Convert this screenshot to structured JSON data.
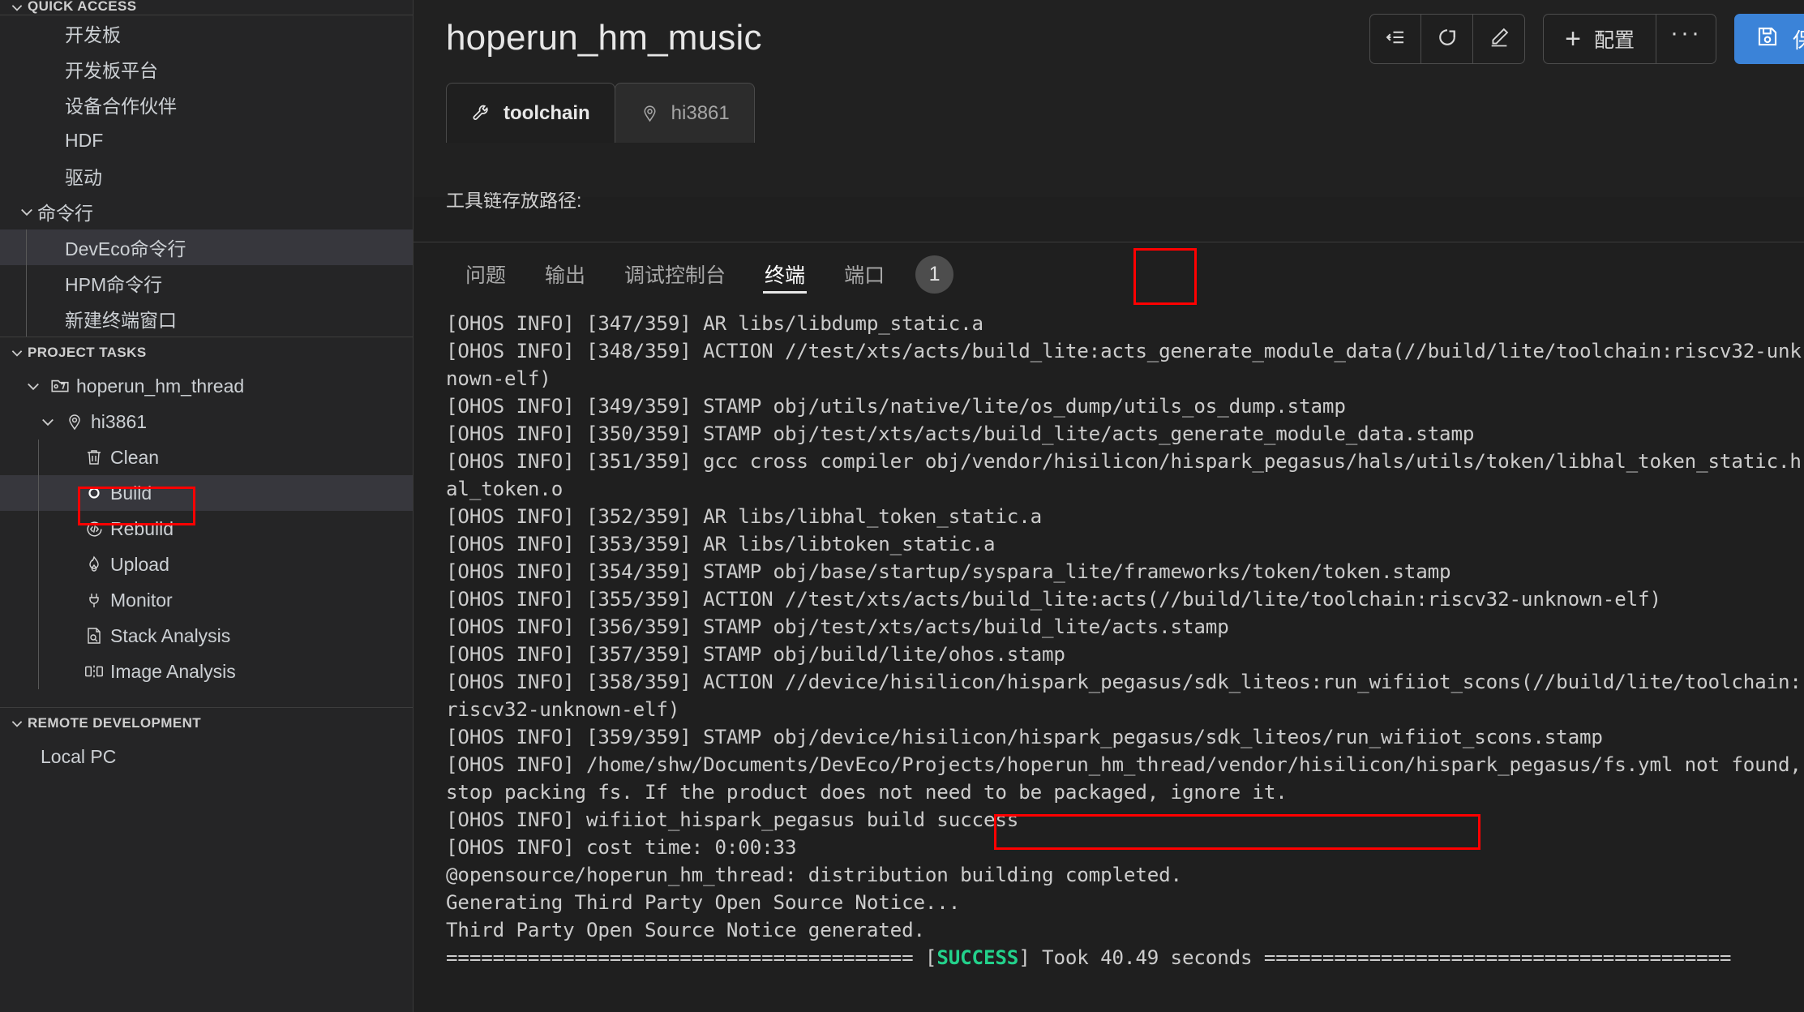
{
  "sidebar": {
    "quick_access": {
      "title": "QUICK ACCESS",
      "items": [
        {
          "label": "开发板"
        },
        {
          "label": "开发板平台"
        },
        {
          "label": "设备合作伙伴"
        },
        {
          "label": "HDF"
        },
        {
          "label": "驱动"
        }
      ],
      "group": {
        "label": "命令行"
      },
      "group_items": [
        {
          "label": "DevEco命令行",
          "selected": true
        },
        {
          "label": "HPM命令行",
          "selected": false
        },
        {
          "label": "新建终端窗口",
          "selected": false
        }
      ]
    },
    "project_tasks": {
      "title": "PROJECT TASKS",
      "root": {
        "label": "hoperun_hm_thread",
        "icon": "folder-project-icon"
      },
      "board": {
        "label": "hi3861",
        "icon": "location-pin-icon"
      },
      "tasks": [
        {
          "label": "Clean",
          "icon": "trash-icon",
          "selected": false
        },
        {
          "label": "Build",
          "icon": "circle-icon",
          "selected": true,
          "highlighted": true
        },
        {
          "label": "Rebuild",
          "icon": "code-circle-icon",
          "selected": false
        },
        {
          "label": "Upload",
          "icon": "flame-icon",
          "selected": false
        },
        {
          "label": "Monitor",
          "icon": "plug-icon",
          "selected": false
        },
        {
          "label": "Stack Analysis",
          "icon": "file-search-icon",
          "selected": false
        },
        {
          "label": "Image Analysis",
          "icon": "binary-icon",
          "selected": false
        }
      ]
    },
    "remote_development": {
      "title": "REMOTE DEVELOPMENT",
      "items": [
        {
          "label": "Local PC"
        }
      ]
    }
  },
  "header": {
    "title": "hoperun_hm_music",
    "tabs": [
      {
        "label": "toolchain",
        "icon": "wrench-icon",
        "active": true
      },
      {
        "label": "hi3861",
        "icon": "location-pin-icon",
        "active": false
      }
    ],
    "toolbar": {
      "collapse_label": "collapse-all-icon",
      "refresh_label": "refresh-icon",
      "edit_label": "edit-pencil-icon",
      "config_label": "配置",
      "config_plus": "+",
      "more_label": "···",
      "save_label": "保",
      "accent_color": "#3b83d8"
    },
    "subtitle": "工具链存放路径:"
  },
  "panel": {
    "tabs": [
      {
        "label": "问题",
        "active": false
      },
      {
        "label": "输出",
        "active": false
      },
      {
        "label": "调试控制台",
        "active": false
      },
      {
        "label": "终端",
        "active": true,
        "highlighted": true
      },
      {
        "label": "端口",
        "active": false
      }
    ],
    "port_badge": "1"
  },
  "terminal": {
    "lines": [
      "[OHOS INFO] [347/359] AR libs/libdump_static.a",
      "[OHOS INFO] [348/359] ACTION //test/xts/acts/build_lite:acts_generate_module_data(//build/lite/toolchain:riscv32-unknown-elf)",
      "[OHOS INFO] [349/359] STAMP obj/utils/native/lite/os_dump/utils_os_dump.stamp",
      "[OHOS INFO] [350/359] STAMP obj/test/xts/acts/build_lite/acts_generate_module_data.stamp",
      "[OHOS INFO] [351/359] gcc cross compiler obj/vendor/hisilicon/hispark_pegasus/hals/utils/token/libhal_token_static.hal_token.o",
      "[OHOS INFO] [352/359] AR libs/libhal_token_static.a",
      "[OHOS INFO] [353/359] AR libs/libtoken_static.a",
      "[OHOS INFO] [354/359] STAMP obj/base/startup/syspara_lite/frameworks/token/token.stamp",
      "[OHOS INFO] [355/359] ACTION //test/xts/acts/build_lite:acts(//build/lite/toolchain:riscv32-unknown-elf)",
      "[OHOS INFO] [356/359] STAMP obj/test/xts/acts/build_lite/acts.stamp",
      "[OHOS INFO] [357/359] STAMP obj/build/lite/ohos.stamp",
      "[OHOS INFO] [358/359] ACTION //device/hisilicon/hispark_pegasus/sdk_liteos:run_wifiiot_scons(//build/lite/toolchain:riscv32-unknown-elf)",
      "[OHOS INFO] [359/359] STAMP obj/device/hisilicon/hispark_pegasus/sdk_liteos/run_wifiiot_scons.stamp",
      "[OHOS INFO] /home/shw/Documents/DevEco/Projects/hoperun_hm_thread/vendor/hisilicon/hispark_pegasus/fs.yml not found, stop packing fs. If the product does not need to be packaged, ignore it.",
      "[OHOS INFO] wifiiot_hispark_pegasus build success",
      "[OHOS INFO] cost time: 0:00:33",
      "@opensource/hoperun_hm_thread: distribution building completed.",
      "Generating Third Party Open Source Notice...",
      "Third Party Open Source Notice generated."
    ],
    "final_line": {
      "left_rule": "========================================",
      "status": "SUCCESS",
      "status_color": "#23d18b",
      "text": " Took 40.49 seconds ",
      "right_rule": "========================================"
    },
    "highlighted_text": "wifiiot_hispark_pegasus build success"
  }
}
